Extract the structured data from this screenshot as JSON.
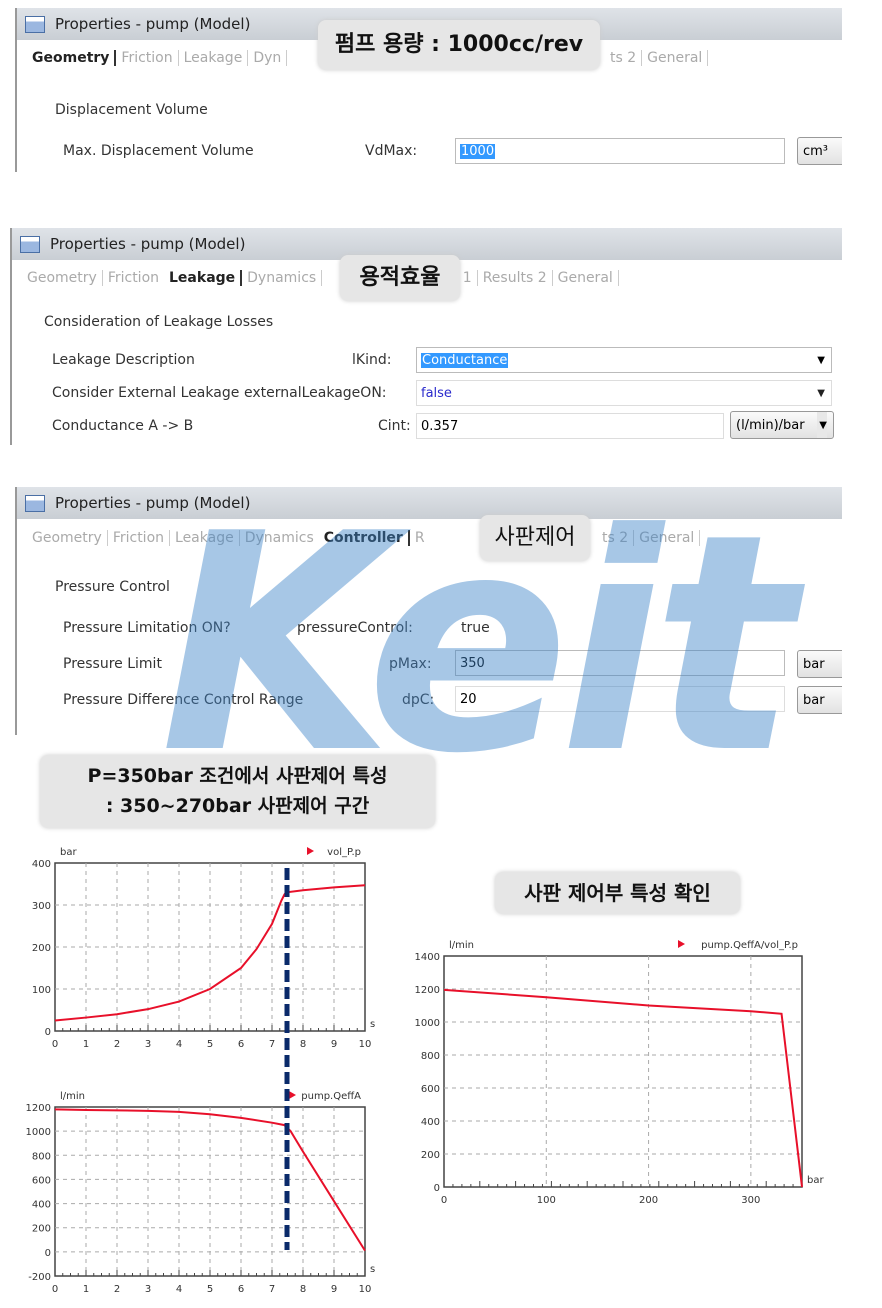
{
  "panels": [
    {
      "title": "Properties - pump (Model)",
      "tabs": [
        "Geometry",
        "Friction",
        "Leakage",
        "Dyn"
      ],
      "tabs_tail": [
        "ts 2",
        "General"
      ],
      "active": "Geometry",
      "group": "Displacement Volume",
      "rows": [
        {
          "label": "Max. Displacement Volume",
          "param": "VdMax:",
          "value": "1000",
          "unit": "cm³"
        }
      ],
      "callout": "펌프 용량 : 1000cc/rev"
    },
    {
      "title": "Properties - pump (Model)",
      "tabs": [
        "Geometry",
        "Friction",
        "Leakage",
        "Dynamics"
      ],
      "tabs_tail": [
        "lts 1",
        "Results 2",
        "General"
      ],
      "active": "Leakage",
      "group": "Consideration of Leakage Losses",
      "rows": [
        {
          "label": "Leakage Description",
          "param": "lKind:",
          "value": "Conductance"
        },
        {
          "label": "Consider External Leakage",
          "param": "externalLeakageON:",
          "value": "false"
        },
        {
          "label": "Conductance A -> B",
          "param": "Cint:",
          "value": "0.357",
          "unit": "(l/min)/bar"
        }
      ],
      "callout": "용적효율"
    },
    {
      "title": "Properties - pump (Model)",
      "tabs": [
        "Geometry",
        "Friction",
        "Leakage",
        "Dynamics",
        "Controller",
        "R"
      ],
      "tabs_tail": [
        "ts 2",
        "General"
      ],
      "active": "Controller",
      "group": "Pressure Control",
      "rows": [
        {
          "label": "Pressure Limitation ON?",
          "param": "pressureControl:",
          "value": "true"
        },
        {
          "label": "Pressure Limit",
          "param": "pMax:",
          "value": "350",
          "unit": "bar"
        },
        {
          "label": "Pressure Difference Control Range",
          "param": "dpC:",
          "value": "20",
          "unit": "bar"
        }
      ],
      "callout": "사판제어"
    }
  ],
  "watermark": "Keit",
  "callout_main": {
    "line1": "P=350bar 조건에서 사판제어 특성",
    "line2": ": 350~270bar 사판제어 구간"
  },
  "callout_right": "사판 제어부 특성 확인",
  "colors": {
    "series": "#e8102a",
    "marker_line": "#0a2a6a"
  },
  "chart_data": [
    {
      "type": "line",
      "ylabel": "bar",
      "xlabel": "s",
      "legend": "vol_P.p",
      "xlim": [
        0,
        10
      ],
      "ylim": [
        0,
        400
      ],
      "xticks": [
        0,
        1,
        2,
        3,
        4,
        5,
        6,
        7,
        8,
        9,
        10
      ],
      "yticks": [
        0,
        100,
        200,
        300,
        400
      ],
      "grid": true,
      "x": [
        0,
        1,
        2,
        3,
        4,
        5,
        6,
        6.5,
        7,
        7.3,
        7.4,
        7.45,
        8,
        9,
        10
      ],
      "y": [
        25,
        32,
        40,
        52,
        70,
        100,
        150,
        195,
        255,
        310,
        325,
        330,
        335,
        342,
        347
      ],
      "vline": 7.4
    },
    {
      "type": "line",
      "ylabel": "l/min",
      "xlabel": "s",
      "legend": "pump.QeffA",
      "xlim": [
        0,
        10
      ],
      "ylim": [
        -200,
        1200
      ],
      "xticks": [
        0,
        1,
        2,
        3,
        4,
        5,
        6,
        7,
        8,
        9,
        10
      ],
      "yticks": [
        -200,
        0,
        200,
        400,
        600,
        800,
        1000,
        1200
      ],
      "grid": true,
      "x": [
        0,
        1,
        2,
        3,
        4,
        5,
        6,
        7,
        7.4,
        7.6,
        8,
        9,
        10
      ],
      "y": [
        1180,
        1175,
        1172,
        1168,
        1160,
        1140,
        1110,
        1070,
        1050,
        1000,
        830,
        420,
        10
      ],
      "vline": 7.4
    },
    {
      "type": "line",
      "ylabel": "l/min",
      "xlabel": "bar",
      "legend": "pump.QeffA/vol_P.p",
      "xlim": [
        0,
        350
      ],
      "ylim": [
        0,
        1400
      ],
      "xticks": [
        0,
        100,
        200,
        300
      ],
      "yticks": [
        0,
        200,
        400,
        600,
        800,
        1000,
        1200,
        1400
      ],
      "grid": true,
      "x": [
        0,
        100,
        200,
        300,
        330,
        350
      ],
      "y": [
        1195,
        1150,
        1100,
        1065,
        1050,
        0
      ]
    }
  ]
}
